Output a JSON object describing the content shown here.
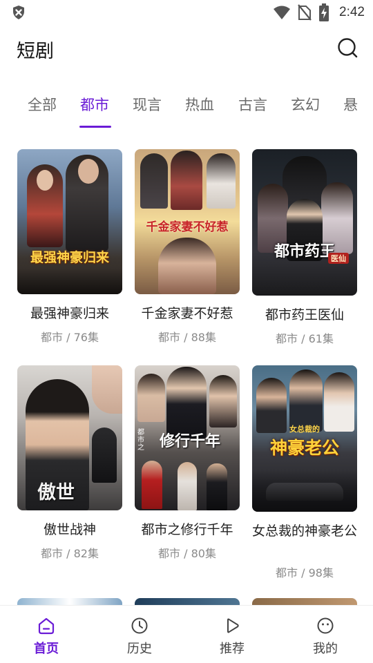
{
  "status_bar": {
    "time": "2:42"
  },
  "header": {
    "title": "短剧"
  },
  "tabs": [
    {
      "label": "全部",
      "active": false
    },
    {
      "label": "都市",
      "active": true
    },
    {
      "label": "现言",
      "active": false
    },
    {
      "label": "热血",
      "active": false
    },
    {
      "label": "古言",
      "active": false
    },
    {
      "label": "玄幻",
      "active": false
    },
    {
      "label": "悬",
      "active": false
    }
  ],
  "dramas": [
    {
      "title": "最强神豪归来",
      "meta": "都市 / 76集",
      "poster_text": "最强神豪归来"
    },
    {
      "title": "千金家妻不好惹",
      "meta": "都市 / 88集",
      "poster_text": "千金家妻不好惹"
    },
    {
      "title": "都市药王医仙",
      "meta": "都市 / 61集",
      "poster_text": "都市药王",
      "poster_badge": "医仙"
    },
    {
      "title": "傲世战神",
      "meta": "都市 / 82集",
      "poster_text": "傲世"
    },
    {
      "title": "都市之修行千年",
      "meta": "都市 / 80集",
      "poster_text": "修行千年",
      "poster_sub": "都市之"
    },
    {
      "title": "女总裁的神豪老公",
      "meta": "都市 / 98集",
      "poster_text": "神豪老公",
      "poster_sub": "女总裁的"
    }
  ],
  "bottom_nav": [
    {
      "label": "首页",
      "icon": "home-icon",
      "active": true
    },
    {
      "label": "历史",
      "icon": "clock-icon",
      "active": false
    },
    {
      "label": "推荐",
      "icon": "play-icon",
      "active": false
    },
    {
      "label": "我的",
      "icon": "smiley-icon",
      "active": false
    }
  ],
  "colors": {
    "accent": "#6a1bd6",
    "text": "#222222",
    "meta": "#8a8a8a",
    "tab_inactive": "#6a6a6a"
  }
}
